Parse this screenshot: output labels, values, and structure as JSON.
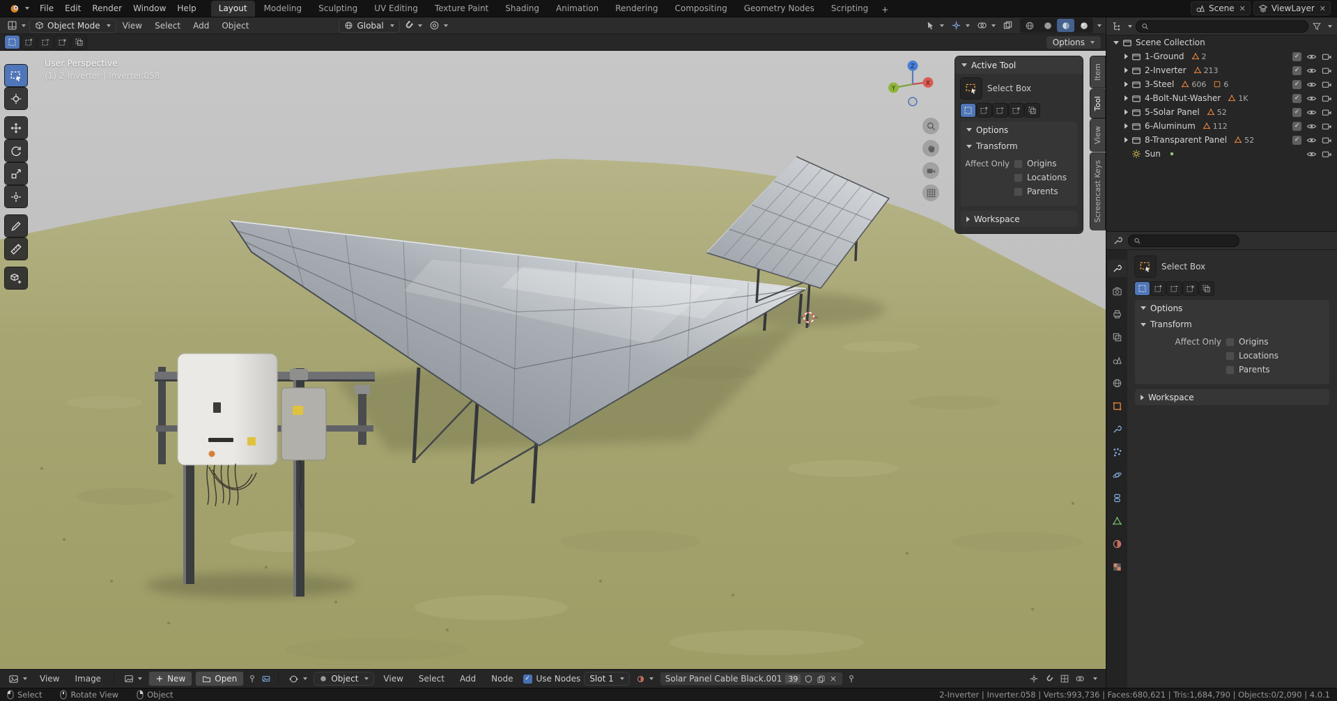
{
  "topbar": {
    "menus": [
      "File",
      "Edit",
      "Render",
      "Window",
      "Help"
    ],
    "workspace_tabs": [
      "Layout",
      "Modeling",
      "Sculpting",
      "UV Editing",
      "Texture Paint",
      "Shading",
      "Animation",
      "Rendering",
      "Compositing",
      "Geometry Nodes",
      "Scripting"
    ],
    "add_workspace_label": "+",
    "scene_name": "Scene",
    "viewlayer_name": "ViewLayer"
  },
  "viewport": {
    "header": {
      "mode": "Object Mode",
      "menus": [
        "View",
        "Select",
        "Add",
        "Object"
      ],
      "orientation": "Global"
    },
    "tool_settings": {
      "options_label": "Options"
    },
    "overlay": {
      "line1": "User Perspective",
      "line2": "(1) 2-Inverter | Inverter.058"
    },
    "gizmo": {
      "x": "X",
      "y": "Y",
      "z": "Z"
    },
    "tools": [
      "select-box",
      "cursor",
      "move",
      "rotate",
      "scale",
      "transform",
      "annotate",
      "measure",
      "add-cube"
    ]
  },
  "sidebar_panel": {
    "tabs": [
      "Item",
      "Tool",
      "View",
      "Screencast Keys"
    ],
    "active_tab": "Tool",
    "active_tool_label": "Active Tool",
    "tool_name": "Select Box",
    "options_label": "Options",
    "transform_label": "Transform",
    "affect_only_label": "Affect Only",
    "affect_options": [
      "Origins",
      "Locations",
      "Parents"
    ],
    "workspace_label": "Workspace"
  },
  "outliner": {
    "root_label": "Scene Collection",
    "items": [
      {
        "name": "1-Ground",
        "counts": [
          "2"
        ]
      },
      {
        "name": "2-Inverter",
        "counts": [
          "213"
        ]
      },
      {
        "name": "3-Steel",
        "counts": [
          "606",
          "6"
        ]
      },
      {
        "name": "4-Bolt-Nut-Washer",
        "counts": [
          "1K"
        ]
      },
      {
        "name": "5-Solar Panel",
        "counts": [
          "52"
        ]
      },
      {
        "name": "6-Aluminum",
        "counts": [
          "112"
        ]
      },
      {
        "name": "8-Transparent Panel",
        "counts": [
          "52"
        ]
      },
      {
        "name": "Sun",
        "counts": []
      }
    ]
  },
  "properties": {
    "tool_name": "Select Box",
    "options_label": "Options",
    "transform_label": "Transform",
    "affect_only_label": "Affect Only",
    "affect_options": [
      "Origins",
      "Locations",
      "Parents"
    ],
    "workspace_label": "Workspace"
  },
  "image_editor": {
    "menus": [
      "View",
      "Image"
    ],
    "new_label": "New",
    "open_label": "Open"
  },
  "shader_editor": {
    "type": "Object",
    "menus": [
      "View",
      "Select",
      "Add",
      "Node"
    ],
    "use_nodes_label": "Use Nodes",
    "slot_label": "Slot 1",
    "material_name": "Solar Panel Cable Black.001",
    "users_count": "39"
  },
  "status_bar": {
    "hints": [
      "Select",
      "Rotate View",
      "Object"
    ],
    "stats": "2-Inverter | Inverter.058 | Verts:993,736 | Faces:680,621 | Tris:1,684,790 | Objects:0/2,090 | 4.0.1"
  },
  "colors": {
    "accent": "#4772b3",
    "selection_orange": "#e8853d"
  }
}
